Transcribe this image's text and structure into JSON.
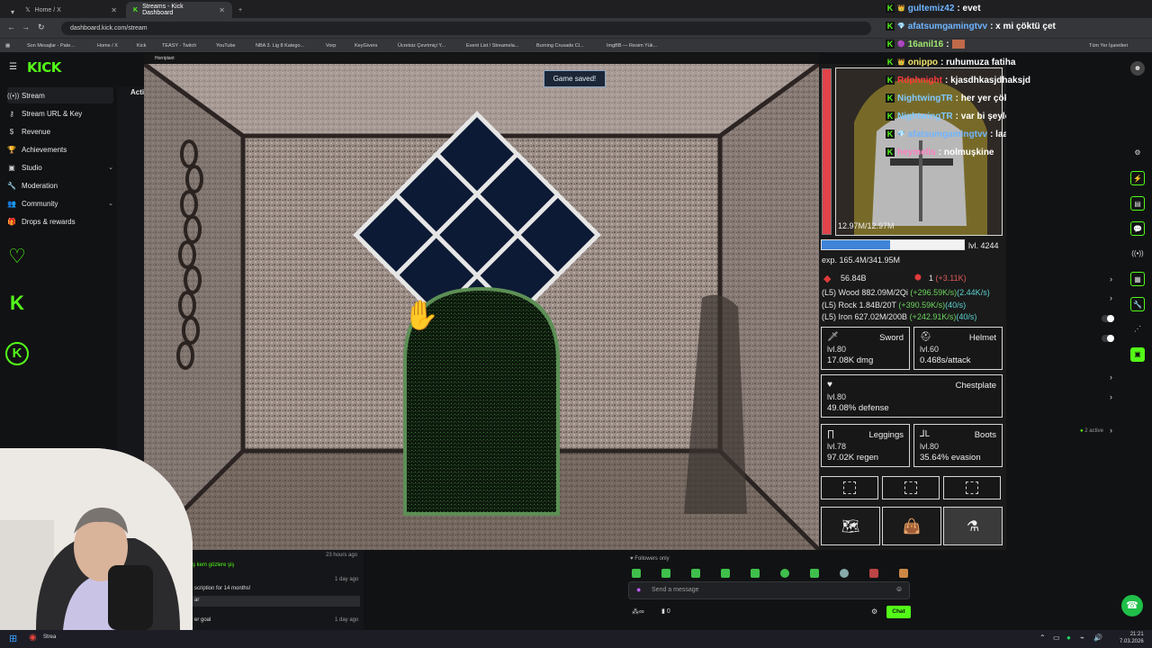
{
  "browser": {
    "tabs": [
      {
        "label": "Home / X",
        "active": false
      },
      {
        "label": "Streams - Kick Dashboard",
        "active": true
      }
    ],
    "url": "dashboard.kick.com/stream",
    "bookmarks": [
      "Son Mesajlar - Pate...",
      "Home / X",
      "Kick",
      "TEASY - Twitch",
      "YouTube",
      "NBA 3. Lig 8 Katego...",
      "Vorp",
      "KeyGivers",
      "Ücretsiz Çevrimiçi Y...",
      "Event List / Streamela...",
      "Burning Crusade Cl...",
      "ImgBB — Resim Yük..."
    ],
    "other_bookmarks": "Tüm Yer İşaretleri"
  },
  "kick": {
    "logo": "KICK",
    "sidebar": [
      {
        "label": "Stream",
        "icon": "broadcast-icon",
        "active": true
      },
      {
        "label": "Stream URL & Key",
        "icon": "key-icon"
      },
      {
        "label": "Revenue",
        "icon": "dollar-icon"
      },
      {
        "label": "Achievements",
        "icon": "trophy-icon"
      },
      {
        "label": "Studio",
        "icon": "studio-icon",
        "chevron": true
      },
      {
        "label": "Moderation",
        "icon": "wrench-icon"
      },
      {
        "label": "Community",
        "icon": "users-icon",
        "chevron": true
      },
      {
        "label": "Drops & rewards",
        "icon": "gift-icon"
      }
    ],
    "activity_header": "Acti",
    "activity_times": [
      "23 hours ago",
      "1 day ago",
      "1 day ago"
    ],
    "activity_snippets": [
      "ş kem gözlere şiş",
      "scription for 14 months!",
      "ar",
      "er goal"
    ],
    "followers_only": "Followers only",
    "chat_placeholder": "Send a message",
    "chat_button": "Chat",
    "viewer_count": "0",
    "active_count": "2 active"
  },
  "game": {
    "window_title": "Horriplant",
    "toast": "Game saved!",
    "hp": "12.97M/12.97M",
    "level": "lvl. 4244",
    "exp": "exp. 165.4M/341.95M",
    "xp_fraction": 0.48,
    "gold": "56.84B",
    "gems": "1",
    "gems_rate": "(+3.11K)",
    "resources": [
      {
        "prefix": "(L5) Wood 882.09M/2Qi ",
        "rate": "(+296.59K/s)",
        "cap": "(2.44K/s)"
      },
      {
        "prefix": "(L5) Rock 1.84B/20T ",
        "rate": "(+390.59K/s)",
        "cap": "(40/s)"
      },
      {
        "prefix": "(L5) Iron 627.02M/200B ",
        "rate": "(+242.91K/s)",
        "cap": "(40/s)"
      }
    ],
    "equipment": [
      {
        "name": "Sword",
        "level": "lvl.80",
        "stat": "17.08K dmg",
        "icon": "sword-icon"
      },
      {
        "name": "Helmet",
        "level": "lvl.60",
        "stat": "0.468s/attack",
        "icon": "helmet-icon"
      },
      {
        "name": "Chestplate",
        "level": "lvl.80",
        "stat": "49.08% defense",
        "icon": "chestplate-icon"
      },
      {
        "name": "Leggings",
        "level": "lvl.78",
        "stat": "97.02K regen",
        "icon": "leggings-icon"
      },
      {
        "name": "Boots",
        "level": "lvl.80",
        "stat": "35.64% evasion",
        "icon": "boots-icon"
      }
    ],
    "actions": [
      "map-icon",
      "bag-icon",
      "potion-icon"
    ]
  },
  "chat_overlay": [
    {
      "user": "gultemiz42",
      "msg": ": evet",
      "color": "#6fb5ff"
    },
    {
      "user": "afatsumgamingtvv",
      "msg": ": x mi çöktü çet",
      "color": "#6fb5ff"
    },
    {
      "user": "16anil16",
      "msg": ":",
      "color": "#9fe870"
    },
    {
      "user": "onippo",
      "msg": ": ruhumuza fatiha",
      "color": "#f0e36a"
    },
    {
      "user": "Rdphnight",
      "msg": ": kjasdhkasjdhaksjd",
      "color": "#ff3a3a"
    },
    {
      "user": "NightwingTR",
      "msg": ": her yer çökenzi mustafa",
      "color": "#7fc8ff"
    },
    {
      "user": "NightwingTR",
      "msg": ": var bi şeyler",
      "color": "#7fc8ff"
    },
    {
      "user": "afatsumgamingtvv",
      "msg": ": laaaaanet olsun",
      "color": "#6fb5ff"
    },
    {
      "user": "heymelis",
      "msg": ": nolmuşkine",
      "color": "#ff7fbf"
    }
  ],
  "taskbar": {
    "time": "21:21",
    "date": "7.03.2026",
    "app_label": "Strea"
  },
  "colors": {
    "kick_green": "#53fc18",
    "hp_red": "#e0434a",
    "xp_blue": "#3f84d9"
  }
}
